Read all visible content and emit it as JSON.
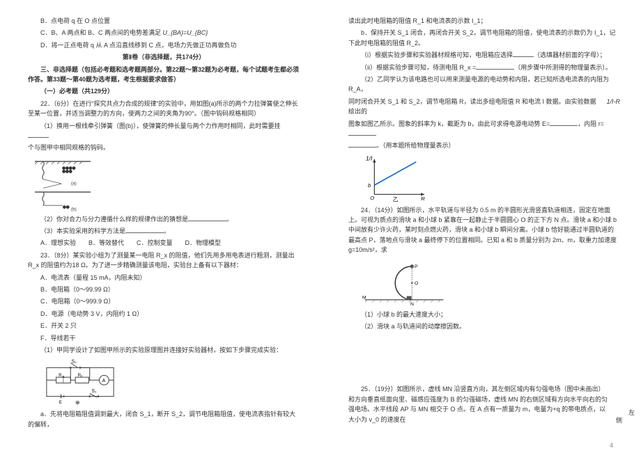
{
  "left": {
    "optB": "B．点电荷 q 在 O 点位置",
    "optC_prefix": "C．B、A 两点和 B、C 两点间的电势差满足 ",
    "optC_formula": "U_{BA}=U_{BC}",
    "optD": "D．将一正点电荷 q 从 A 点沿直线移到 C 点，电场力先做正功再做负功",
    "section2_title": "第Ⅱ卷（非选择题，共174分）",
    "section3": "三、非选择题（包括必考题和选考题两部分。第22题～第32题为必考题，每个试题考生都必须作答。第33题～第40题为选考题，考生根据要求做答）",
    "required_title": "（一）必考题（共129分）",
    "q22": "22．（6分）在进行“探究共点力合成的规律”的实验中，用如图(a)所示的两个力拉弹簧使之伸长至某一位置，并适当调整力的方向，使两力之间的夹角为90°。（图中钩码规格相同）",
    "q22_1": "（1）换用一根线牵引弹簧（图(b)），使弹簧的伸长量与两个力作用时相同，此时需要挂",
    "q22_1b": "个与图甲中相同规格的钩码。",
    "q22_2": "（2）你对合力与分力遵循什么样的规律作出的猜想是",
    "q22_2b": "。",
    "q22_3": "（3）本实验采用的科学方法是",
    "q22_3b": "。",
    "q22_3opts": "A．理想实验　　B．等效替代　　C．控制变量　　D．物理模型",
    "q23": "23．（8分）某实验小组为了测量某一电阻 R_x 的阻值，他们先用多用电表进行粗测，测量出 R_x 的阻值约为18 Ω。为了进一步精确测量该电阻，实验台上备有以下器材：",
    "q23_A": "A．电流表（量程 15 mA，内阻未知）",
    "q23_B": "B．电阻箱（0～99.99 Ω）",
    "q23_C": "C．电阻箱（0～999.9 Ω）",
    "q23_D": "D．电源（电动势 3 V，内阻约 1 Ω）",
    "q23_E": "E．开关 2 只",
    "q23_F": "F．导线若干",
    "q23_1": "（1）甲同学设计了如图甲所示的实验原理图并连接好实验器材，按如下步骤完成实验：",
    "q23_step_a": "a．先将电阻箱阻值调到最大，闭合 S_1，断开 S_2，调节电阻箱阻值，使电流表指针有较大的偏转，"
  },
  "right": {
    "line1": "读出此时电阻箱的阻值 R_1 和电流表的示数 I_1；",
    "step_b": "b．保持开关 S_1 闭合，再闭合开关 S_2，调节电阻箱的阻值，使电流表的示数仍为 I_1，记下此时电阻箱的阻值 R_2。",
    "r_i": "（i）根据实验步骤和实验器材规格可知，电阻箱应选择",
    "r_i_b": "（选填器材前面的字母）；",
    "r_ii": "（ii）根据实验步骤可知，待测电阻 R_x =",
    "r_ii_b": "（用步骤中所测得的物理量表示）。",
    "q23_2": "（2）乙同学认为该电路也可以用来测量电源的电动势和内阻，若已知所选电流表的内阻为 R_A，",
    "q23_2b_pre": "同时闭合开关 S_1 和 S_2，调节电阻箱 R，读出多组电阻值 R 和电流 I 数据。由实验数据绘出的",
    "q23_2b_suf_pre": "图象如图乙所示。图象的斜率为 k，截距为 b，由此可求得电源电动势 E=",
    "q23_2b_suf_mid": "，内阻 r=",
    "q23_2b_suf_end": "。（用本题所给物理量表示）",
    "chart_label_y": "1/I",
    "chart_label_x": "R",
    "chart_label_o": "O",
    "chart_label_b": "b",
    "chart_caption": "乙",
    "q24": "24．（14分）如图所示，水平轨道与半径为 0.5 m 的半圆形光滑竖直轨道相连，固定在地面上。可视为质点的滑块 a 和小球 b 紧靠在一起静止于半圆圆心 O 的正下方 N 点。滑块 a 和小球 b 中间放有少许火药，某时刻点燃火药，滑块 a 和小球 b 瞬间分离。小球 b 恰好能通过半圆轨道的最高点 P，落地点与滑块 a 最终停下的位置相同。已知 a 和 b 质量分别为 2m、m，取重力加速度 g=10m/s²，求",
    "fig2_P": "P",
    "fig2_O": "O",
    "fig2_M": "M",
    "fig2_N": "N",
    "q24_1": "（1）小球 b 的最大速度大小；",
    "q24_2": "（2）滑块 a 与轨道间的动摩擦因数。",
    "q25": "25．（19分）如图所示，虚线 MN 沿竖直方向，其左侧区域内有匀强电场（图中未画出）和方向垂直纸面向里、磁感应强度为 B 的匀强磁场，虚线 MN 的右侧区域有方向水平向右的匀强电场。水平线段 AP 与 MN 相交于 O 点。在 A 点有一质量为 m，电量为+q 的带电质点，以大小为 v_0 的速度在",
    "margin_text": "左 侧",
    "formula_1R": "1/I-R"
  },
  "pagenum": "4",
  "chart_data": {
    "type": "line",
    "title": "",
    "xlabel": "R",
    "ylabel": "1/I",
    "intercept_label": "b",
    "origin_label": "O",
    "description": "Straight line with positive slope, y-intercept b>0",
    "series": [
      {
        "name": "line",
        "points_sketch": [
          [
            0,
            1
          ],
          [
            5,
            5
          ]
        ]
      }
    ]
  }
}
